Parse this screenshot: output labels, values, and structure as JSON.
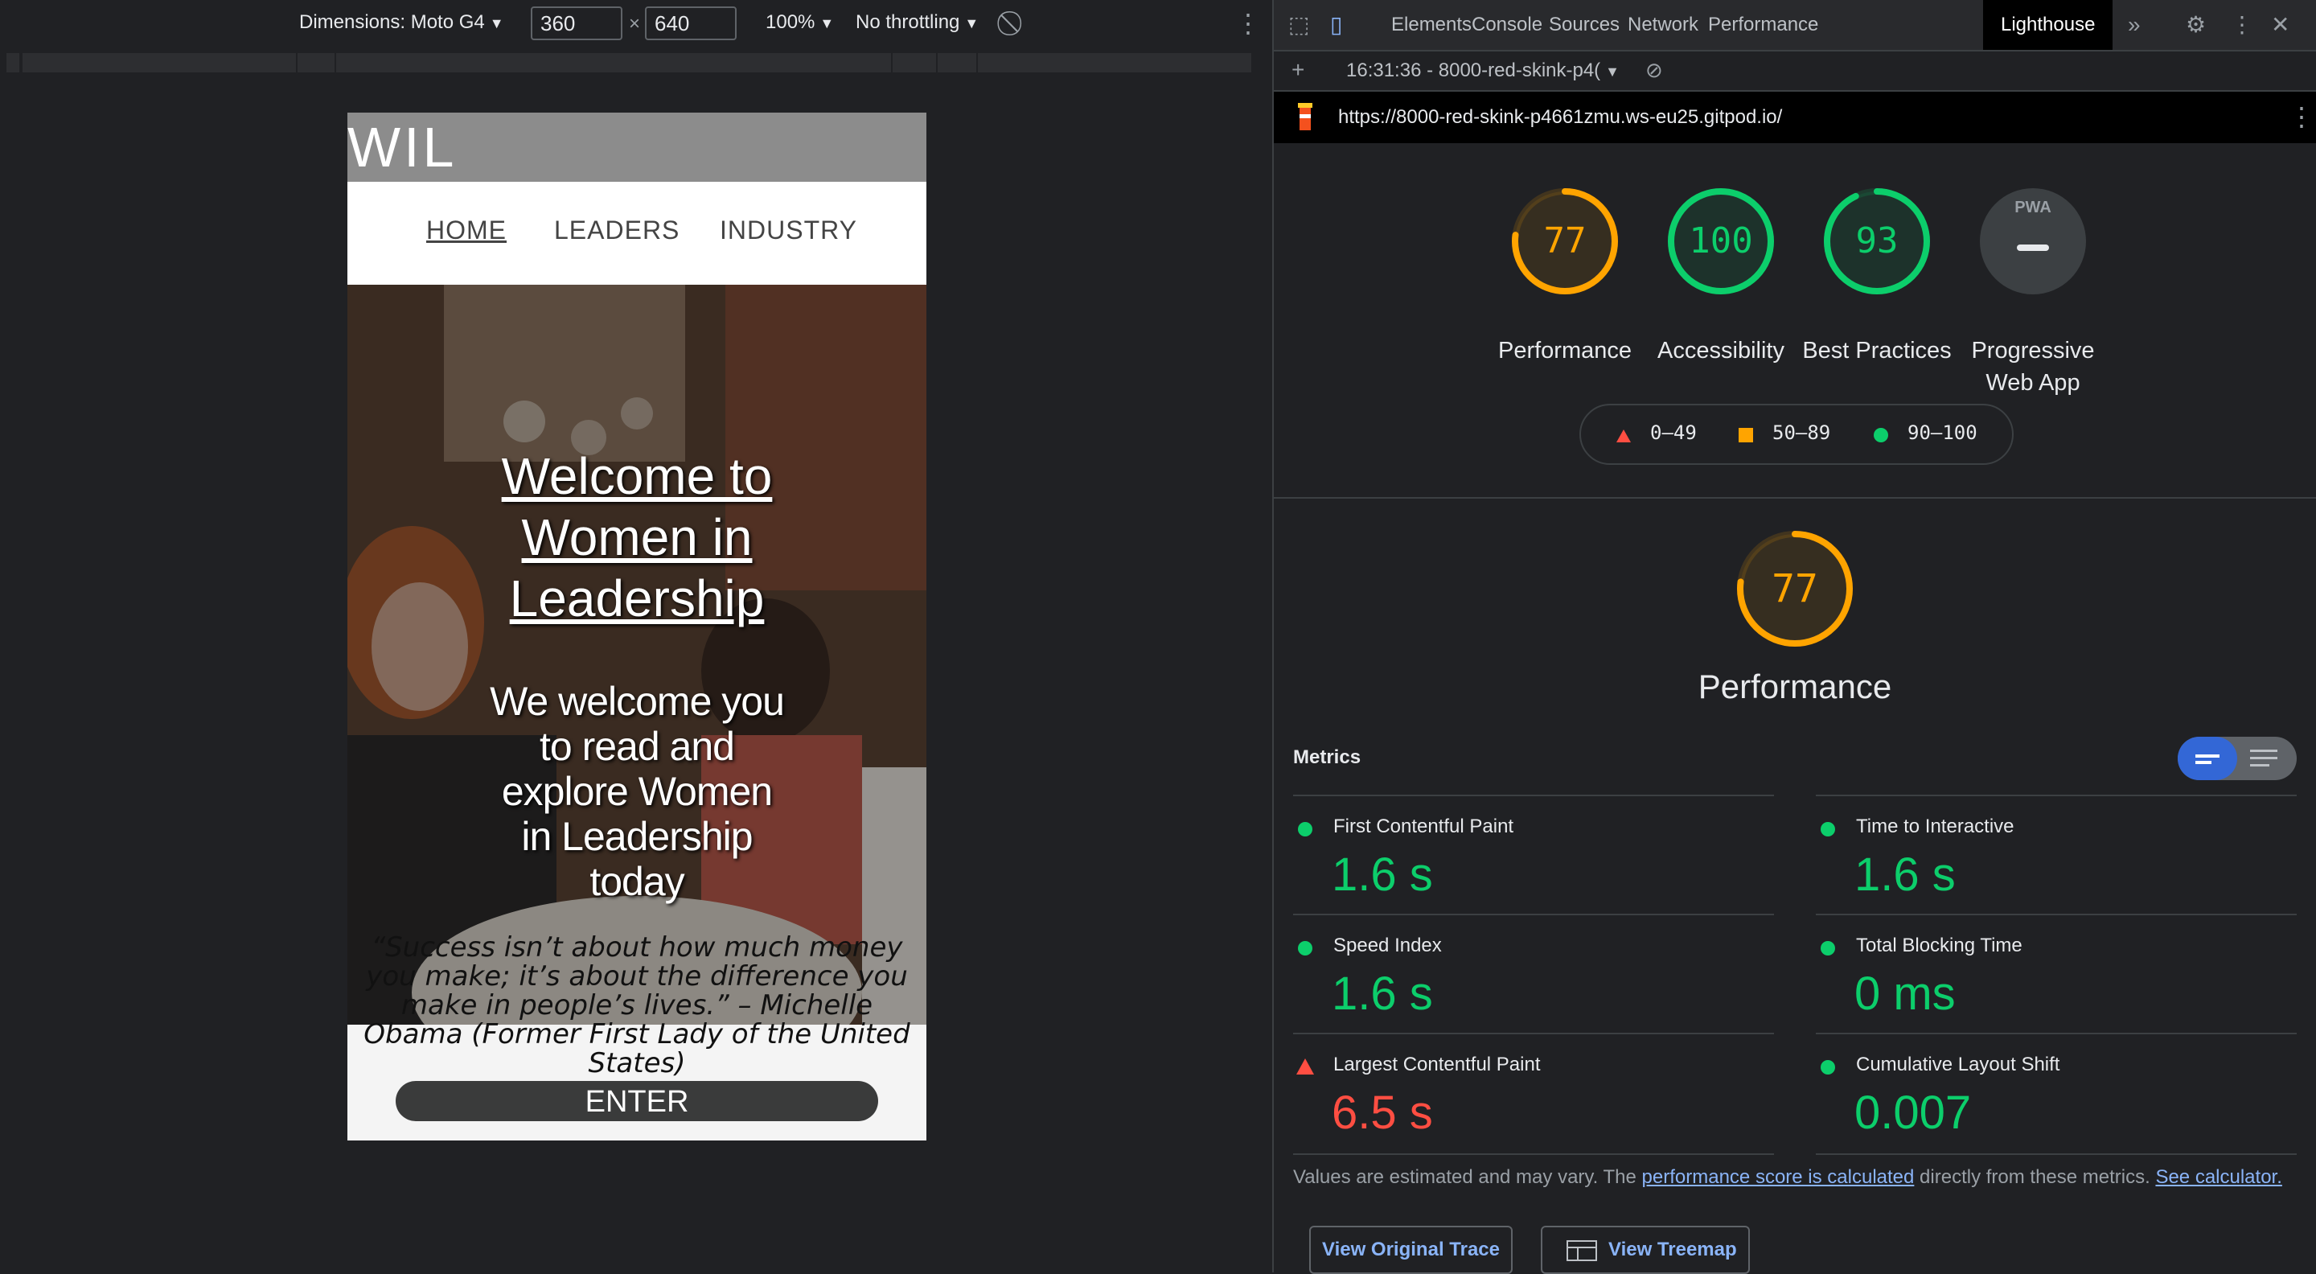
{
  "device_toolbar": {
    "dimensions_label": "Dimensions: Moto G4",
    "width_value": "360",
    "height_value": "640",
    "times": "×",
    "zoom": "100%",
    "throttling": "No throttling"
  },
  "site": {
    "logo": "WIL",
    "nav": [
      "HOME",
      "LEADERS",
      "INDUSTRY"
    ],
    "hero_title": [
      "Welcome to",
      "Women in",
      "Leadership"
    ],
    "hero_text": "We welcome you to read and explore Women in Leadership today",
    "quote": "“Success isn’t about how much money you make; it’s about the difference you make in people’s lives.” – Michelle Obama (Former First Lady of the United States)",
    "enter_button": "ENTER"
  },
  "devtools": {
    "tabs": [
      "Elements",
      "Console",
      "Sources",
      "Network",
      "Performance",
      "Lighthouse"
    ],
    "active_tab": "Lighthouse",
    "report_select": "16:31:36 - 8000-red-skink-p4(",
    "url": "https://8000-red-skink-p4661zmu.ws-eu25.gitpod.io/"
  },
  "scores": [
    {
      "value": "77",
      "label": "Performance",
      "score": 77,
      "color": "#ffa400"
    },
    {
      "value": "100",
      "label": "Accessibility",
      "score": 100,
      "color": "#0cce6b"
    },
    {
      "value": "93",
      "label": "Best Practices",
      "score": 93,
      "color": "#0cce6b"
    },
    {
      "value": "PWA",
      "label": "Progressive Web App",
      "score": null,
      "color": "#9aa0a6"
    }
  ],
  "legend": [
    {
      "range": "0–49",
      "color": "#ff4e42",
      "shape": "triangle"
    },
    {
      "range": "50–89",
      "color": "#ffa400",
      "shape": "square"
    },
    {
      "range": "90–100",
      "color": "#0cce6b",
      "shape": "circle"
    }
  ],
  "performance": {
    "score": "77",
    "title": "Performance",
    "metrics_heading": "Metrics",
    "metrics": [
      {
        "title": "First Contentful Paint",
        "value": "1.6 s",
        "status": "pass"
      },
      {
        "title": "Time to Interactive",
        "value": "1.6 s",
        "status": "pass"
      },
      {
        "title": "Speed Index",
        "value": "1.6 s",
        "status": "pass"
      },
      {
        "title": "Total Blocking Time",
        "value": "0 ms",
        "status": "pass"
      },
      {
        "title": "Largest Contentful Paint",
        "value": "6.5 s",
        "status": "fail"
      },
      {
        "title": "Cumulative Layout Shift",
        "value": "0.007",
        "status": "pass"
      }
    ],
    "note_prefix": "Values are estimated and may vary. The ",
    "note_link": "performance score is calculated",
    "note_middle": " directly from these metrics. ",
    "note_calc": "See calculator.",
    "btn_trace": "View Original Trace",
    "btn_treemap": "View Treemap"
  },
  "colors": {
    "pass": "#0cce6b",
    "average": "#ffa400",
    "fail": "#ff4e42",
    "accent": "#3367d6"
  }
}
